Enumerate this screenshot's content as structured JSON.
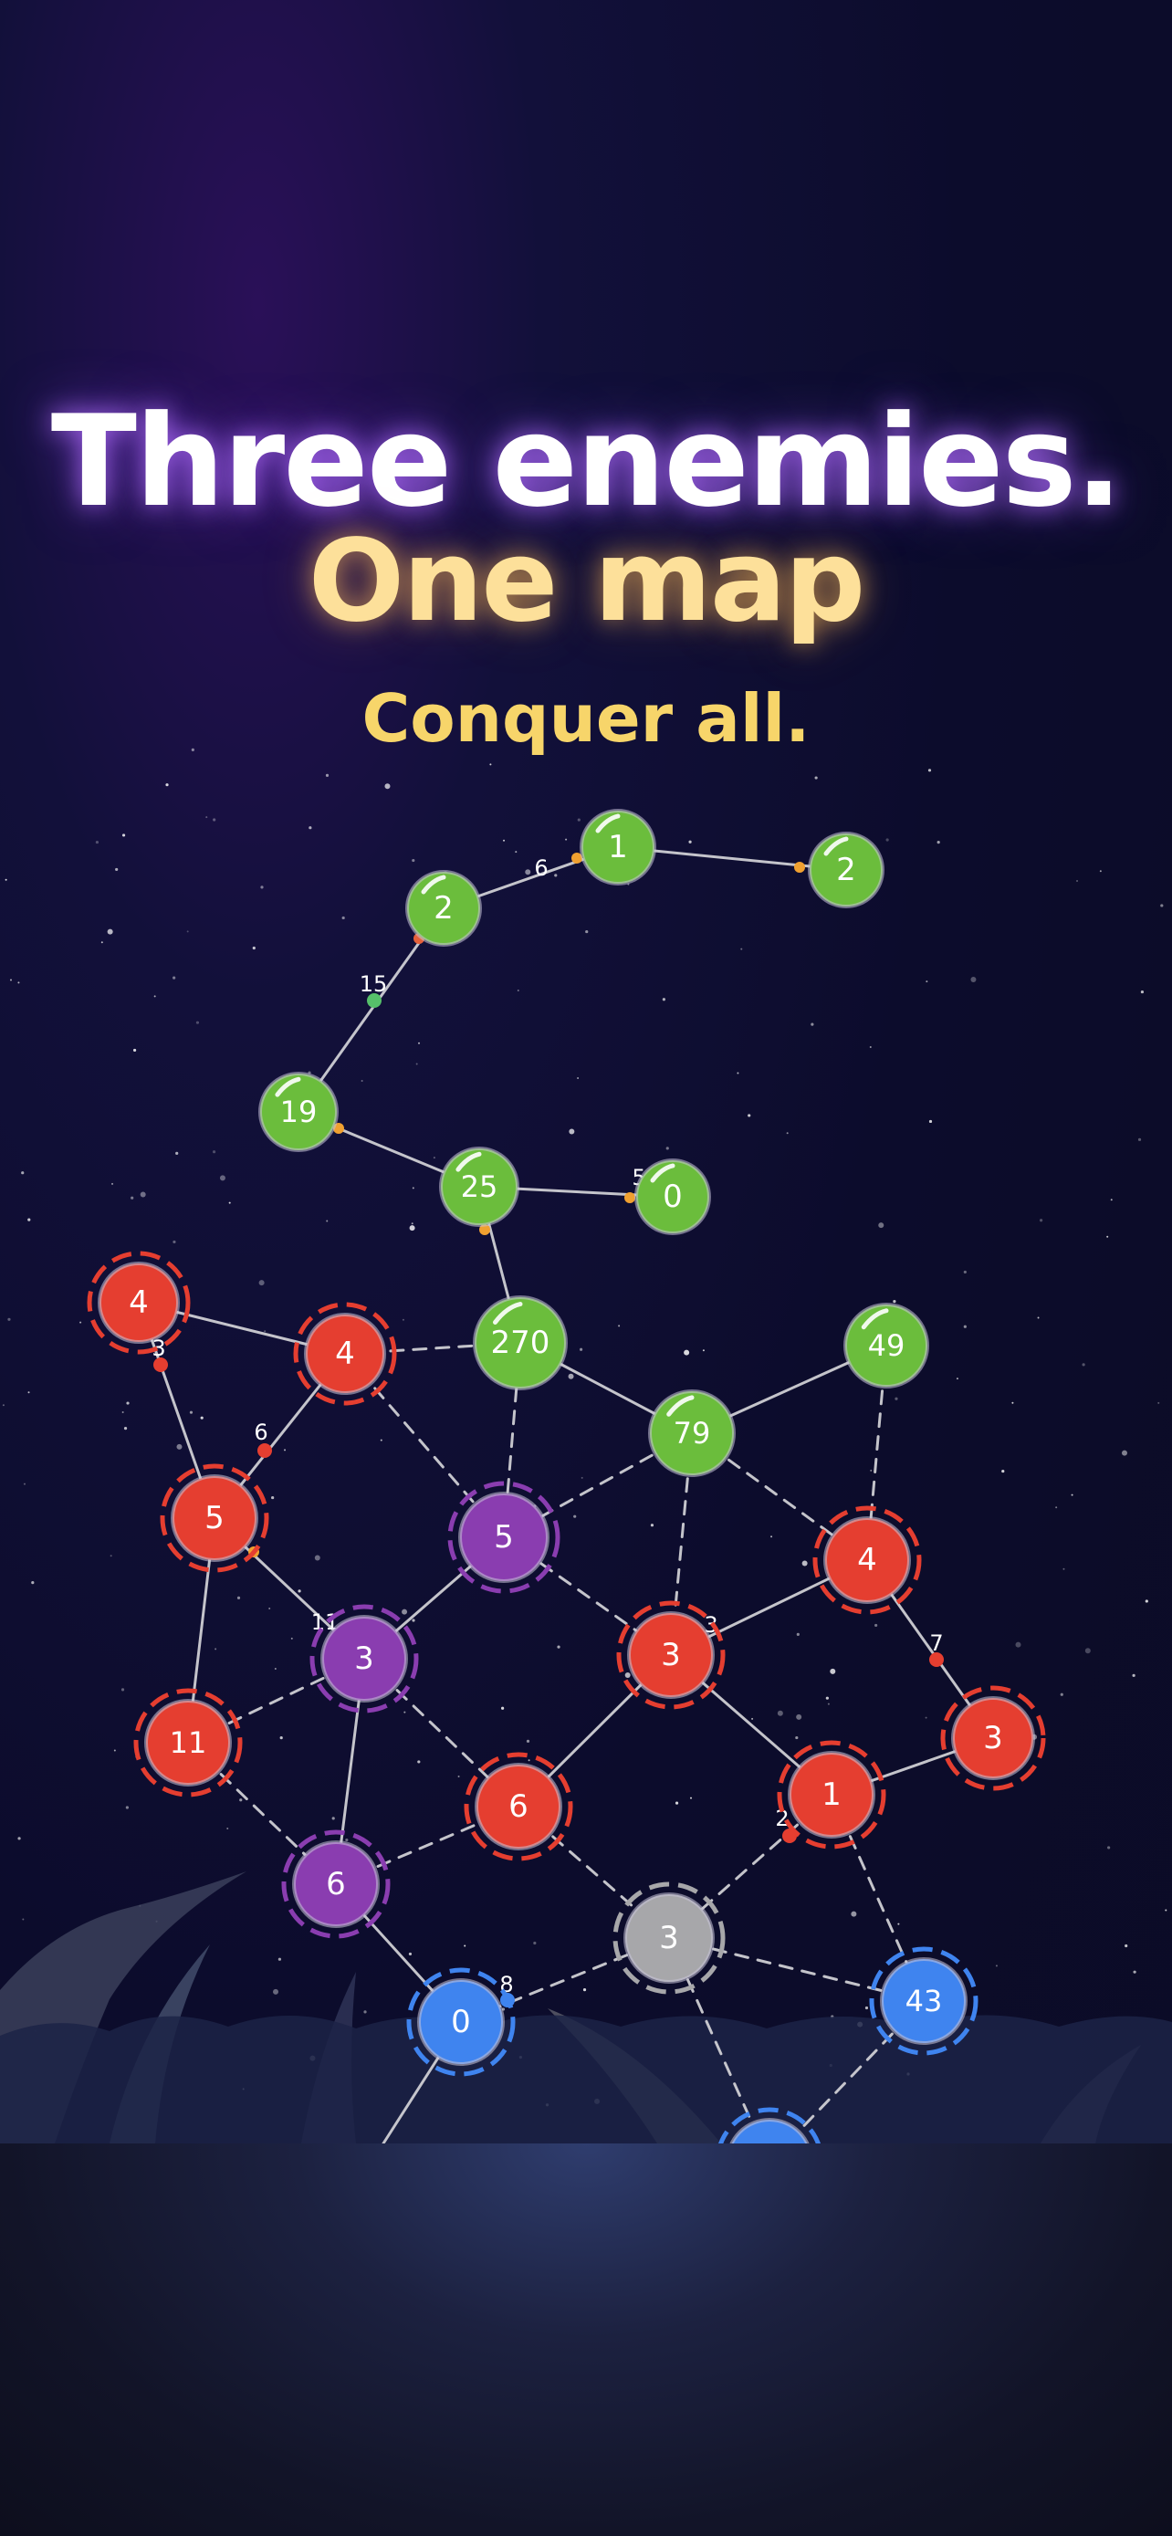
{
  "headline": {
    "line1": "Three enemies.",
    "line2": "One map",
    "tagline": "Conquer all."
  },
  "colors": {
    "green": "#6bbd3c",
    "red": "#e53e30",
    "purple": "#8a3db0",
    "blue": "#3f84ef",
    "gray": "#a7a7aa",
    "edge": "#d8d8dc",
    "headline_white": "#ffffff",
    "headline_gold": "#fde09a",
    "tagline_gold": "#f7d56a"
  },
  "nodes": [
    {
      "id": "g1",
      "label": "1",
      "color": "green"
    },
    {
      "id": "g2a",
      "label": "2",
      "color": "green"
    },
    {
      "id": "g2b",
      "label": "2",
      "color": "green"
    },
    {
      "id": "g19",
      "label": "19",
      "color": "green"
    },
    {
      "id": "g25",
      "label": "25",
      "color": "green"
    },
    {
      "id": "g0",
      "label": "0",
      "color": "green"
    },
    {
      "id": "g270",
      "label": "270",
      "color": "green"
    },
    {
      "id": "g49",
      "label": "49",
      "color": "green"
    },
    {
      "id": "g79",
      "label": "79",
      "color": "green"
    },
    {
      "id": "r4a",
      "label": "4",
      "color": "red"
    },
    {
      "id": "r4b",
      "label": "4",
      "color": "red"
    },
    {
      "id": "r5",
      "label": "5",
      "color": "red"
    },
    {
      "id": "r11",
      "label": "11",
      "color": "red"
    },
    {
      "id": "r3a",
      "label": "3",
      "color": "red"
    },
    {
      "id": "r4c",
      "label": "4",
      "color": "red"
    },
    {
      "id": "r3b",
      "label": "3",
      "color": "red"
    },
    {
      "id": "r6",
      "label": "6",
      "color": "red"
    },
    {
      "id": "r1",
      "label": "1",
      "color": "red"
    },
    {
      "id": "p5",
      "label": "5",
      "color": "purple"
    },
    {
      "id": "p3",
      "label": "3",
      "color": "purple"
    },
    {
      "id": "p6",
      "label": "6",
      "color": "purple"
    },
    {
      "id": "n3",
      "label": "3",
      "color": "gray"
    },
    {
      "id": "b0",
      "label": "0",
      "color": "blue"
    },
    {
      "id": "b43",
      "label": "43",
      "color": "blue"
    },
    {
      "id": "bx",
      "label": "",
      "color": "blue"
    }
  ],
  "edge_labels": [
    {
      "id": "e-g2a-g1",
      "text": "6"
    },
    {
      "id": "e-g19-g2a",
      "text": "15"
    },
    {
      "id": "e-g25-g0",
      "text": "5"
    },
    {
      "id": "e-r4a-r5",
      "text": "3"
    },
    {
      "id": "e-r5-r4b",
      "text": "6"
    },
    {
      "id": "e-r5-p3",
      "text": "11"
    },
    {
      "id": "e-r3a-p5",
      "text": "3"
    },
    {
      "id": "e-r4c-r3b",
      "text": "7"
    },
    {
      "id": "e-r1-n3",
      "text": "2"
    },
    {
      "id": "e-b0-n3",
      "text": "8"
    }
  ]
}
